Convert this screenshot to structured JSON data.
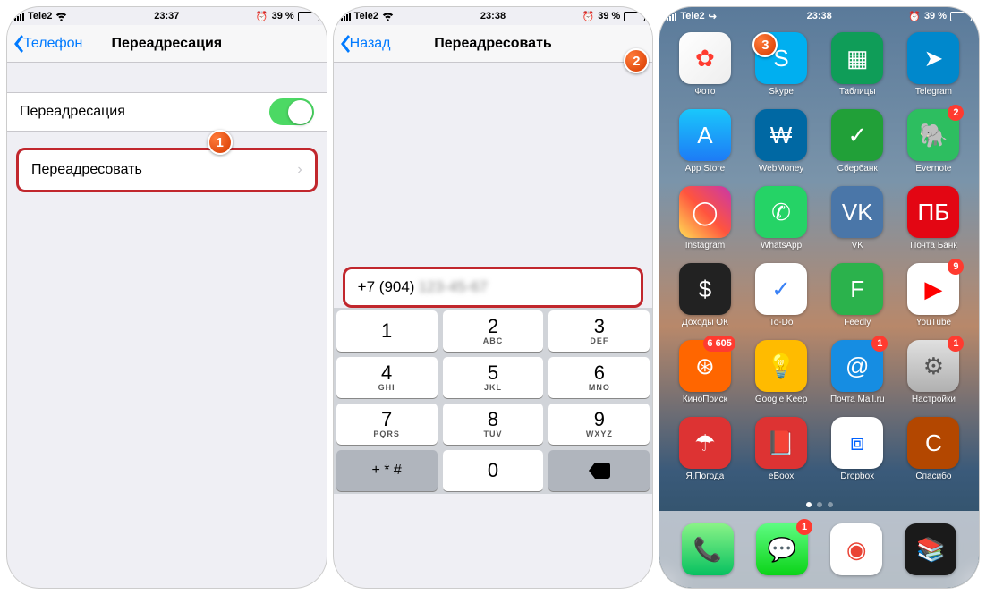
{
  "status": {
    "carrier": "Tele2",
    "time1": "23:37",
    "time2": "23:38",
    "time3": "23:38",
    "battery": "39 %"
  },
  "screen1": {
    "back": "Телефон",
    "title": "Переадресация",
    "toggle_label": "Переадресация",
    "forward_label": "Переадресовать"
  },
  "screen2": {
    "back": "Назад",
    "title": "Переадресовать",
    "number_prefix": "+7 (904)",
    "keypad": [
      [
        {
          "n": "1",
          "l": ""
        },
        {
          "n": "2",
          "l": "ABC"
        },
        {
          "n": "3",
          "l": "DEF"
        }
      ],
      [
        {
          "n": "4",
          "l": "GHI"
        },
        {
          "n": "5",
          "l": "JKL"
        },
        {
          "n": "6",
          "l": "MNO"
        }
      ],
      [
        {
          "n": "7",
          "l": "PQRS"
        },
        {
          "n": "8",
          "l": "TUV"
        },
        {
          "n": "9",
          "l": "WXYZ"
        }
      ]
    ],
    "sym_key": "+ * #",
    "zero_key": "0"
  },
  "callouts": {
    "c1": "1",
    "c2": "2",
    "c3": "3"
  },
  "apps": [
    {
      "label": "Фото",
      "bg": "linear-gradient(135deg,#fff,#eee)",
      "icon": "✿",
      "color": "#ff3b30"
    },
    {
      "label": "Skype",
      "bg": "#00aff0",
      "icon": "S"
    },
    {
      "label": "Таблицы",
      "bg": "#0f9d58",
      "icon": "▦"
    },
    {
      "label": "Telegram",
      "bg": "#0088cc",
      "icon": "➤"
    },
    {
      "label": "App Store",
      "bg": "linear-gradient(180deg,#1ac7fb,#1d7bf6)",
      "icon": "A"
    },
    {
      "label": "WebMoney",
      "bg": "#0068a3",
      "icon": "₩"
    },
    {
      "label": "Сбербанк",
      "bg": "#21a038",
      "icon": "✓"
    },
    {
      "label": "Evernote",
      "bg": "#2dbe60",
      "icon": "🐘",
      "badge": "2"
    },
    {
      "label": "Instagram",
      "bg": "linear-gradient(45deg,#fd5,#ff543e,#c837ab)",
      "icon": "◯"
    },
    {
      "label": "WhatsApp",
      "bg": "#25d366",
      "icon": "✆"
    },
    {
      "label": "VK",
      "bg": "#4a76a8",
      "icon": "VK"
    },
    {
      "label": "Почта Банк",
      "bg": "#e30613",
      "icon": "ПБ"
    },
    {
      "label": "Доходы ОК",
      "bg": "#222",
      "icon": "$"
    },
    {
      "label": "To-Do",
      "bg": "#fff",
      "icon": "✓",
      "color": "#3b82f6"
    },
    {
      "label": "Feedly",
      "bg": "#2bb24c",
      "icon": "F"
    },
    {
      "label": "YouTube",
      "bg": "#fff",
      "icon": "▶",
      "color": "#ff0000",
      "badge": "9"
    },
    {
      "label": "КиноПоиск",
      "bg": "#ff6600",
      "icon": "⊛",
      "badge": "6 605"
    },
    {
      "label": "Google Keep",
      "bg": "#ffbb00",
      "icon": "💡"
    },
    {
      "label": "Почта Mail.ru",
      "bg": "#168de2",
      "icon": "@",
      "badge": "1"
    },
    {
      "label": "Настройки",
      "bg": "linear-gradient(#e0e0e0,#b0b0b0)",
      "icon": "⚙",
      "color": "#555",
      "badge": "1"
    },
    {
      "label": "Я.Погода",
      "bg": "#d33",
      "icon": "☂"
    },
    {
      "label": "eBoox",
      "bg": "#d33",
      "icon": "📕"
    },
    {
      "label": "Dropbox",
      "bg": "#fff",
      "icon": "⧈",
      "color": "#0061ff"
    },
    {
      "label": "Спасибо",
      "bg": "#b34700",
      "icon": "С"
    }
  ],
  "dock": [
    {
      "bg": "linear-gradient(180deg,#89f387,#07c160)",
      "icon": "📞"
    },
    {
      "bg": "linear-gradient(180deg,#5efc82,#0bd318)",
      "icon": "💬",
      "badge": "1"
    },
    {
      "bg": "#fff",
      "icon": "◉",
      "color": "#ea4335"
    },
    {
      "bg": "#1a1a1a",
      "icon": "📚"
    }
  ]
}
